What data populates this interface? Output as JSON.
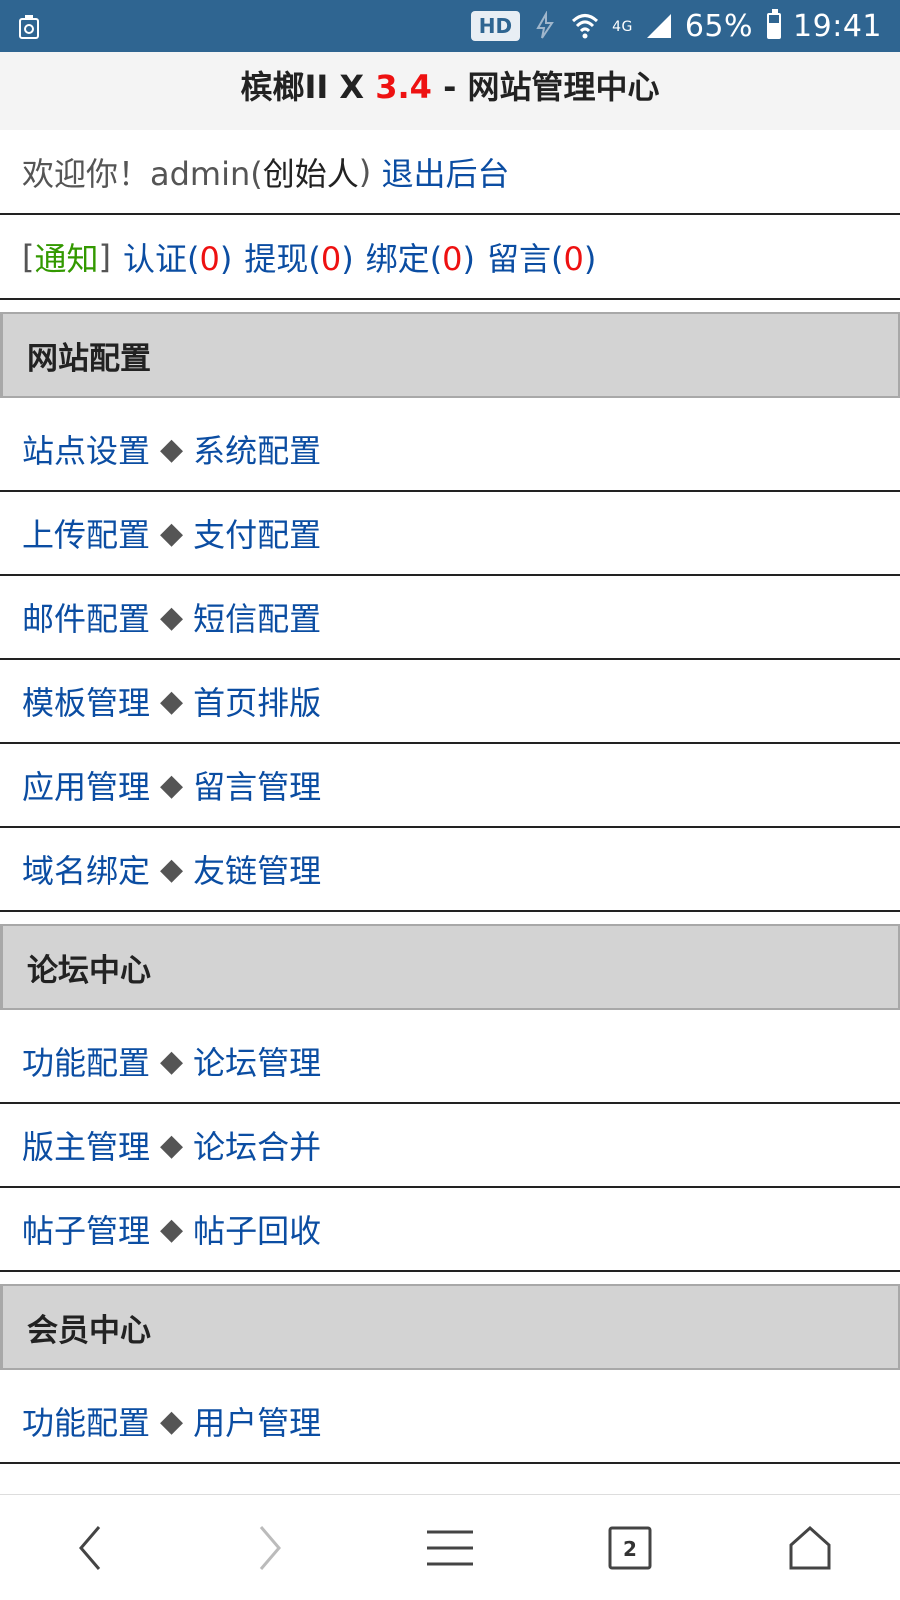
{
  "status_bar": {
    "left_icon": "recycle-notification-icon",
    "hd": "HD",
    "network": "4G",
    "battery": "65%",
    "battery_level": 0.65,
    "time": "19:41"
  },
  "header": {
    "title_prefix": "槟榔II X ",
    "version": "3.4",
    "title_suffix": " - 网站管理中心"
  },
  "welcome": {
    "greeting": "欢迎你！admin(",
    "role": "创始人",
    "close_paren": ")",
    "logout": "退出后台"
  },
  "notices": {
    "open_bracket": "[",
    "notice_label": "通知",
    "close_bracket": "]",
    "items": [
      {
        "label": "认证",
        "count": "0"
      },
      {
        "label": "提现",
        "count": "0"
      },
      {
        "label": "绑定",
        "count": "0"
      },
      {
        "label": "留言",
        "count": "0"
      }
    ]
  },
  "sections": [
    {
      "title": "网站配置",
      "rows": [
        [
          "站点设置",
          "系统配置"
        ],
        [
          "上传配置",
          "支付配置"
        ],
        [
          "邮件配置",
          "短信配置"
        ],
        [
          "模板管理",
          "首页排版"
        ],
        [
          "应用管理",
          "留言管理"
        ],
        [
          "域名绑定",
          "友链管理"
        ]
      ]
    },
    {
      "title": "论坛中心",
      "rows": [
        [
          "功能配置",
          "论坛管理"
        ],
        [
          "版主管理",
          "论坛合并"
        ],
        [
          "帖子管理",
          "帖子回收"
        ]
      ]
    },
    {
      "title": "会员中心",
      "rows": [
        [
          "功能配置",
          "用户管理"
        ]
      ]
    }
  ],
  "separator": "◆",
  "nav": {
    "tab_count": "2"
  }
}
